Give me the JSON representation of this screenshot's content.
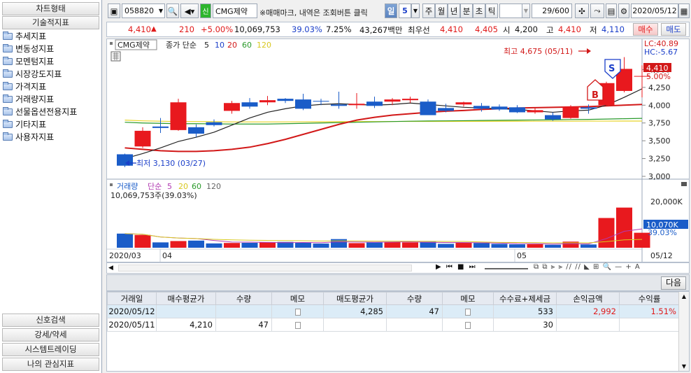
{
  "left_panel": {
    "top_tabs": [
      "차트형태",
      "기술적지표"
    ],
    "tree": [
      "추세지표",
      "변동성지표",
      "모멘텀지표",
      "시장강도지표",
      "가격지표",
      "거래량지표",
      "선물옵션전용지표",
      "기타지표",
      "사용자지표"
    ],
    "bottom_tabs": [
      "신호검색",
      "강세/약세",
      "시스템트레이딩",
      "나의 관심지표"
    ]
  },
  "toolbar": {
    "code": "058820",
    "credit_badge": "신",
    "stock_name": "CMG제약",
    "hint": "※매매마크, 내역은 조회버튼 클릭",
    "periods": [
      "일",
      "5",
      "주",
      "월",
      "년",
      "분",
      "초",
      "틱"
    ],
    "count": "29/600",
    "date": "2020/05/12"
  },
  "quote": {
    "price": "4,410",
    "change": "210",
    "change_pct": "+5.00%",
    "volume": "10,069,753",
    "turnover_pct": "39.03%",
    "vol_ratio": "7.25%",
    "amount": "43,267백만",
    "best_label": "최우선",
    "ask": "4,410",
    "bid": "4,405",
    "open_label": "시",
    "open": "4,200",
    "high_label": "고",
    "high": "4,410",
    "low_label": "저",
    "low": "4,110",
    "buy_label": "매수",
    "sell_label": "매도"
  },
  "price_panel": {
    "stock": "CMG제약",
    "legend_label": "종가 단순",
    "ma_periods": [
      "5",
      "10",
      "20",
      "60",
      "120"
    ],
    "lc": "LC:40.89",
    "hc": "HC:-5.67",
    "current": "4,410",
    "current_pct": "5.00%",
    "max_label": "최고 4,675 (05/11)",
    "min_label": "최저 3,130 (03/27)",
    "buy_mark": "B",
    "sell_mark": "S",
    "y_ticks": [
      "4,500",
      "4,250",
      "4,000",
      "3,750",
      "3,500",
      "3,250",
      "3,000"
    ]
  },
  "volume_panel": {
    "legend_label": "거래량",
    "legend_ma": "단순",
    "ma_periods": [
      "5",
      "20",
      "60",
      "120"
    ],
    "info": "10,069,753주(39.03%)",
    "y_ticks": [
      "20,000K",
      "10,000K"
    ],
    "current": "10,070K",
    "current_pct": "39.03%",
    "x_labels": [
      "2020/03",
      "04",
      "05",
      "05/12"
    ]
  },
  "chart_data": {
    "type": "candlestick",
    "ylim": [
      3000,
      4750
    ],
    "candles": [
      {
        "o": 3310,
        "h": 3320,
        "l": 3130,
        "c": 3150,
        "v": 9500
      },
      {
        "o": 3420,
        "h": 3690,
        "l": 3400,
        "c": 3640,
        "v": 8600
      },
      {
        "o": 3700,
        "h": 3820,
        "l": 3610,
        "c": 3680,
        "v": 3600
      },
      {
        "o": 3650,
        "h": 4090,
        "l": 3640,
        "c": 4040,
        "v": 4500
      },
      {
        "o": 3690,
        "h": 3730,
        "l": 3550,
        "c": 3600,
        "v": 4800
      },
      {
        "o": 3760,
        "h": 3800,
        "l": 3700,
        "c": 3720,
        "v": 2900
      },
      {
        "o": 3920,
        "h": 4060,
        "l": 3880,
        "c": 4030,
        "v": 3200
      },
      {
        "o": 4040,
        "h": 4100,
        "l": 3950,
        "c": 3980,
        "v": 3300
      },
      {
        "o": 4040,
        "h": 4130,
        "l": 4000,
        "c": 4070,
        "v": 3800
      },
      {
        "o": 4090,
        "h": 4100,
        "l": 4030,
        "c": 4060,
        "v": 3900
      },
      {
        "o": 4080,
        "h": 4160,
        "l": 3930,
        "c": 3950,
        "v": 3400
      },
      {
        "o": 4060,
        "h": 4090,
        "l": 4000,
        "c": 4050,
        "v": 2800
      },
      {
        "o": 4010,
        "h": 4190,
        "l": 3950,
        "c": 3990,
        "v": 5800
      },
      {
        "o": 4000,
        "h": 4170,
        "l": 3950,
        "c": 4020,
        "v": 3100
      },
      {
        "o": 4050,
        "h": 4120,
        "l": 3960,
        "c": 3990,
        "v": 3500
      },
      {
        "o": 4050,
        "h": 4100,
        "l": 4000,
        "c": 4080,
        "v": 4000
      },
      {
        "o": 4070,
        "h": 4120,
        "l": 4030,
        "c": 4090,
        "v": 3600
      },
      {
        "o": 4050,
        "h": 4080,
        "l": 3940,
        "c": 3860,
        "v": 4000
      },
      {
        "o": 3960,
        "h": 4020,
        "l": 3900,
        "c": 3920,
        "v": 2600
      },
      {
        "o": 4010,
        "h": 4050,
        "l": 3980,
        "c": 4040,
        "v": 3300
      },
      {
        "o": 3990,
        "h": 4030,
        "l": 3910,
        "c": 3950,
        "v": 3200
      },
      {
        "o": 3980,
        "h": 4010,
        "l": 3920,
        "c": 3940,
        "v": 2600
      },
      {
        "o": 3970,
        "h": 4000,
        "l": 3890,
        "c": 3900,
        "v": 2300
      },
      {
        "o": 3900,
        "h": 3960,
        "l": 3880,
        "c": 3930,
        "v": 2400
      },
      {
        "o": 3860,
        "h": 3900,
        "l": 3780,
        "c": 3800,
        "v": 2000
      },
      {
        "o": 3820,
        "h": 4000,
        "l": 3810,
        "c": 3980,
        "v": 4100
      },
      {
        "o": 3970,
        "h": 4010,
        "l": 3880,
        "c": 3950,
        "v": 2200
      },
      {
        "o": 4000,
        "h": 4330,
        "l": 3990,
        "c": 4310,
        "v": 20000
      },
      {
        "o": 4200,
        "h": 4675,
        "l": 4180,
        "c": 4510,
        "v": 27000
      },
      {
        "o": 4410,
        "h": 4560,
        "l": 4110,
        "c": 4410,
        "v": 10070
      }
    ],
    "ma5": [
      3250,
      3320,
      3400,
      3490,
      3550,
      3620,
      3720,
      3820,
      3900,
      3950,
      3990,
      4010,
      4020,
      4010,
      4000,
      4010,
      4030,
      4010,
      3990,
      3970,
      3960,
      3950,
      3940,
      3920,
      3900,
      3920,
      3930,
      4000,
      4110,
      4230
    ],
    "ma20": [
      3400,
      3380,
      3360,
      3350,
      3350,
      3360,
      3380,
      3410,
      3460,
      3520,
      3590,
      3660,
      3730,
      3790,
      3830,
      3860,
      3880,
      3900,
      3915,
      3925,
      3940,
      3950,
      3960,
      3965,
      3970,
      3975,
      3980,
      3990,
      4000,
      4010
    ],
    "ma60": [
      3760,
      3750,
      3745,
      3740,
      3740,
      3738,
      3735,
      3735,
      3735,
      3740,
      3745,
      3750,
      3755,
      3760,
      3765,
      3770,
      3775,
      3778,
      3780,
      3782,
      3785,
      3788,
      3790,
      3792,
      3795,
      3798,
      3800,
      3805,
      3810,
      3815
    ],
    "ma120": [
      3790,
      3780,
      3775,
      3770,
      3770,
      3768,
      3765,
      3765,
      3765,
      3765,
      3766,
      3767,
      3768,
      3770,
      3770,
      3771,
      3772,
      3772,
      3772,
      3773,
      3773,
      3774,
      3774,
      3775,
      3775,
      3775,
      3776,
      3776,
      3777,
      3777
    ]
  },
  "trade_table": {
    "next_label": "다음",
    "headers": [
      "거래일",
      "매수평균가",
      "수량",
      "메모",
      "매도평균가",
      "수량",
      "메모",
      "수수료+제세금",
      "손익금액",
      "수익률"
    ],
    "rows": [
      {
        "date": "2020/05/12",
        "buy_avg": "",
        "buy_qty": "",
        "sell_avg": "4,285",
        "sell_qty": "47",
        "fee": "533",
        "pnl": "2,992",
        "rate": "1.51%"
      },
      {
        "date": "2020/05/11",
        "buy_avg": "4,210",
        "buy_qty": "47",
        "sell_avg": "",
        "sell_qty": "",
        "fee": "30",
        "pnl": "",
        "rate": ""
      }
    ]
  },
  "colors": {
    "up": "#e8191e",
    "down": "#1a5cc8",
    "ma5": "#222222",
    "ma10": "#1a3ec9",
    "ma20": "#d21818",
    "ma60": "#2a9a2a",
    "ma120": "#e8d428"
  }
}
